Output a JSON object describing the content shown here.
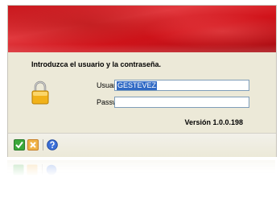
{
  "login": {
    "prompt": "Introduzca el usuario y la contraseña.",
    "username_label": "Usuario:",
    "username_value": "GESTEVEZ",
    "password_label": "Password:",
    "password_value": "",
    "version": "Versión 1.0.0.198"
  },
  "toolbar": {
    "buttons": [
      {
        "name": "accept",
        "icon": "check-icon",
        "color": "#3aa83a"
      },
      {
        "name": "cancel",
        "icon": "close-icon",
        "color": "#e8a33a"
      },
      {
        "name": "help",
        "icon": "help-icon",
        "color": "#3a6fd8"
      }
    ]
  },
  "colors": {
    "banner": "#d1141b",
    "dialog_bg": "#ece9d8",
    "selection": "#316ac5",
    "field_border": "#7f9db9"
  }
}
